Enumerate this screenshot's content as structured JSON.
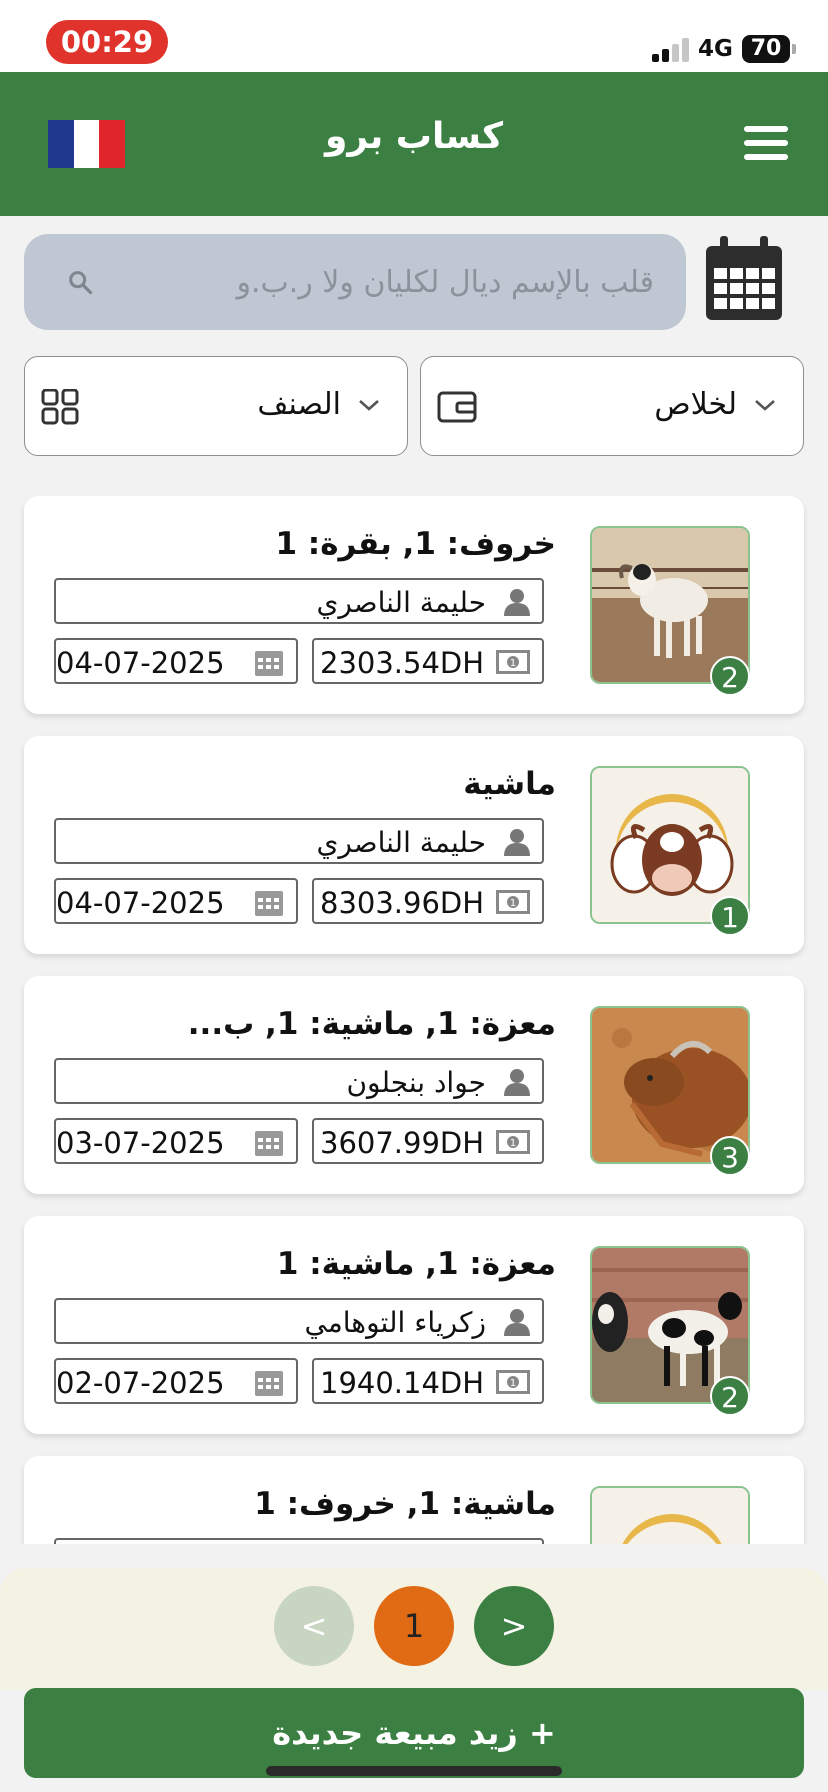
{
  "status_bar": {
    "time": "00:29",
    "network": "4G",
    "battery": "70"
  },
  "header": {
    "title": "كساب برو",
    "flag_colors": [
      "#1f3a8c",
      "#ffffff",
      "#e0252c"
    ]
  },
  "search": {
    "placeholder": "قلب بالإسم ديال لكليان ولا ر.ب.و"
  },
  "filters": {
    "category_label": "الصنف",
    "payment_label": "لخلاص"
  },
  "sales": [
    {
      "title": "خروف: 1, بقرة: 1",
      "client": "حليمة الناصري",
      "amount": "2303.54DH",
      "date": "04-07-2025",
      "count": "2",
      "image": "sheep-photo"
    },
    {
      "title": "ماشية",
      "client": "حليمة الناصري",
      "amount": "8303.96DH",
      "date": "04-07-2025",
      "count": "1",
      "image": "livestock-logo"
    },
    {
      "title": "معزة: 1, ماشية: 1, ب...",
      "client": "جواد بنجلون",
      "amount": "3607.99DH",
      "date": "03-07-2025",
      "count": "3",
      "image": "goat-photo"
    },
    {
      "title": "معزة: 1, ماشية: 1",
      "client": "زكرياء التوهامي",
      "amount": "1940.14DH",
      "date": "02-07-2025",
      "count": "2",
      "image": "goats-photo"
    },
    {
      "title": "ماشية: 1, خروف: 1",
      "image": "livestock-logo"
    }
  ],
  "pagination": {
    "prev": "<",
    "current": "1",
    "next": ">"
  },
  "add_button": {
    "label": "+ زيد مبيعة جديدة"
  },
  "colors": {
    "primary": "#3b7f43",
    "accent": "#e06b14"
  }
}
